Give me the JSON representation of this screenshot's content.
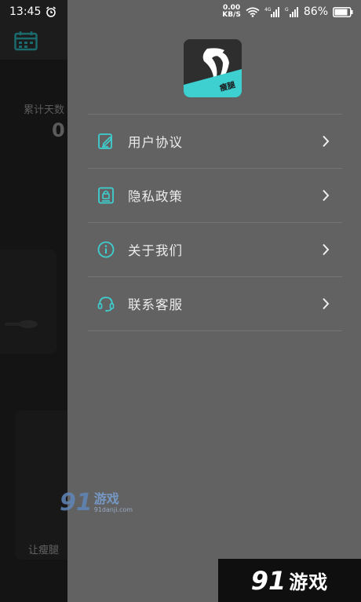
{
  "status_bar": {
    "time": "13:45",
    "net_speed_value": "0.00",
    "net_speed_unit": "KB/S",
    "battery": "86%",
    "icons": [
      "alarm-icon",
      "wifi-icon",
      "signal-4g-icon",
      "signal-icon",
      "battery-icon"
    ]
  },
  "background_page": {
    "stat_label": "累计天数",
    "stat_value": "0",
    "card_caption": "让瘦腿"
  },
  "drawer": {
    "logo_badge": "瘦腿",
    "menu": [
      {
        "label": "用户协议",
        "icon": "edit-doc-icon"
      },
      {
        "label": "隐私政策",
        "icon": "privacy-lock-icon"
      },
      {
        "label": "关于我们",
        "icon": "info-icon"
      },
      {
        "label": "联系客服",
        "icon": "headset-icon"
      }
    ]
  },
  "watermarks": {
    "center_logo": "91",
    "center_text": "游戏",
    "center_url": "91danji.com",
    "corner_logo": "91",
    "corner_text": "游戏"
  },
  "colors": {
    "accent": "#3ecfd0",
    "drawer_bg": "#626262",
    "divider": "#747474"
  }
}
